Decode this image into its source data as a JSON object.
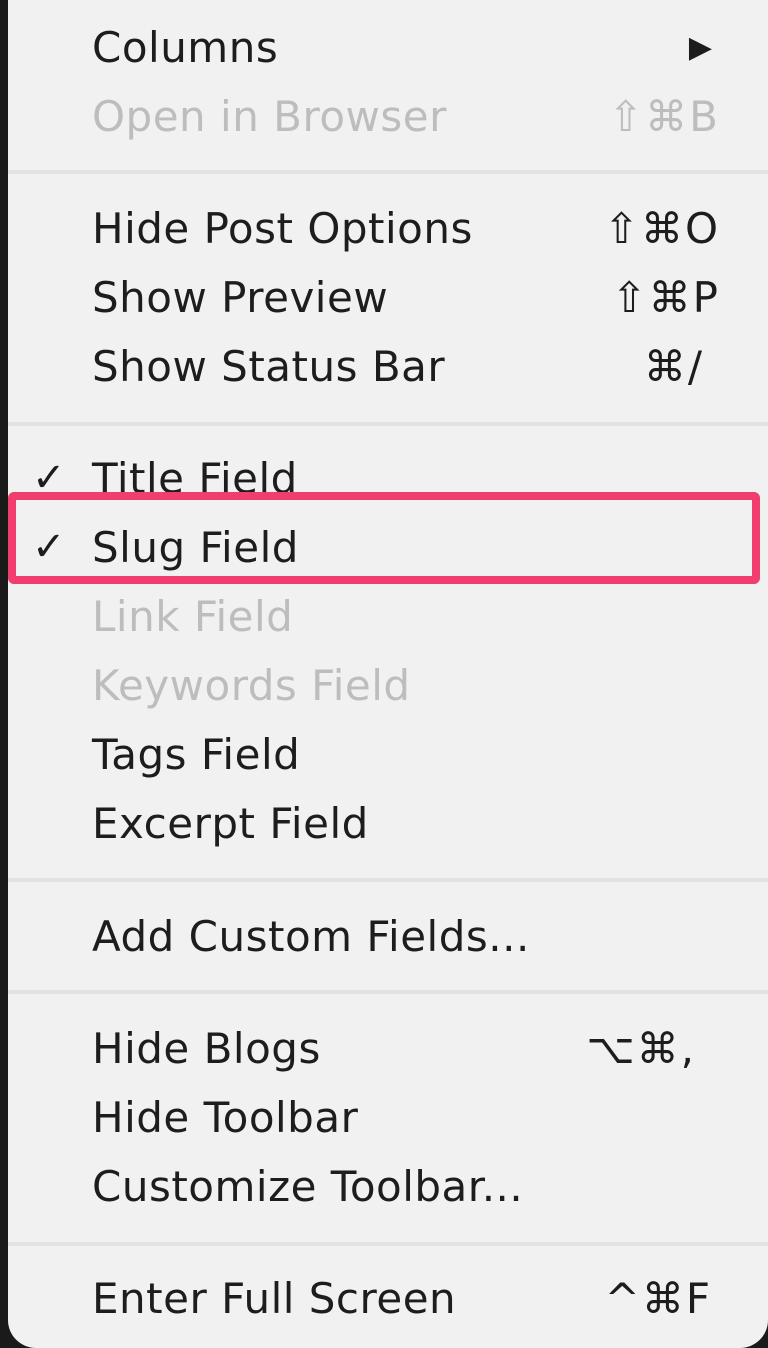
{
  "menu": {
    "sections": [
      {
        "items": [
          {
            "label": "Columns",
            "shortcut": "",
            "checked": false,
            "disabled": false,
            "submenu": true
          },
          {
            "label": "Open in Browser",
            "shortcut": "⇧⌘B",
            "checked": false,
            "disabled": true,
            "submenu": false
          }
        ]
      },
      {
        "items": [
          {
            "label": "Hide Post Options",
            "shortcut": "⇧⌘O",
            "checked": false,
            "disabled": false,
            "submenu": false
          },
          {
            "label": "Show Preview",
            "shortcut": "⇧⌘P",
            "checked": false,
            "disabled": false,
            "submenu": false
          },
          {
            "label": "Show Status Bar",
            "shortcut": "⌘/",
            "checked": false,
            "disabled": false,
            "submenu": false
          }
        ]
      },
      {
        "items": [
          {
            "label": "Title Field",
            "shortcut": "",
            "checked": true,
            "disabled": false,
            "submenu": false
          },
          {
            "label": "Slug Field",
            "shortcut": "",
            "checked": true,
            "disabled": false,
            "submenu": false
          },
          {
            "label": "Link Field",
            "shortcut": "",
            "checked": false,
            "disabled": true,
            "submenu": false
          },
          {
            "label": "Keywords Field",
            "shortcut": "",
            "checked": false,
            "disabled": true,
            "submenu": false
          },
          {
            "label": "Tags Field",
            "shortcut": "",
            "checked": false,
            "disabled": false,
            "submenu": false
          },
          {
            "label": "Excerpt Field",
            "shortcut": "",
            "checked": false,
            "disabled": false,
            "submenu": false
          }
        ]
      },
      {
        "items": [
          {
            "label": "Add Custom Fields...",
            "shortcut": "",
            "checked": false,
            "disabled": false,
            "submenu": false
          }
        ]
      },
      {
        "items": [
          {
            "label": "Hide Blogs",
            "shortcut": "⌥⌘,",
            "checked": false,
            "disabled": false,
            "submenu": false
          },
          {
            "label": "Hide Toolbar",
            "shortcut": "",
            "checked": false,
            "disabled": false,
            "submenu": false
          },
          {
            "label": "Customize Toolbar...",
            "shortcut": "",
            "checked": false,
            "disabled": false,
            "submenu": false
          }
        ]
      },
      {
        "items": [
          {
            "label": "Enter Full Screen",
            "shortcut": "^⌘F",
            "checked": false,
            "disabled": false,
            "submenu": false
          }
        ]
      }
    ],
    "check_glyph": "✓",
    "submenu_glyph": "▶"
  },
  "colors": {
    "menu_bg": "#f1f1f1",
    "text": "#1d1d1d",
    "disabled_text": "#bdbdbd",
    "separator": "#e2e2e2",
    "highlight": "#f23e6f"
  }
}
